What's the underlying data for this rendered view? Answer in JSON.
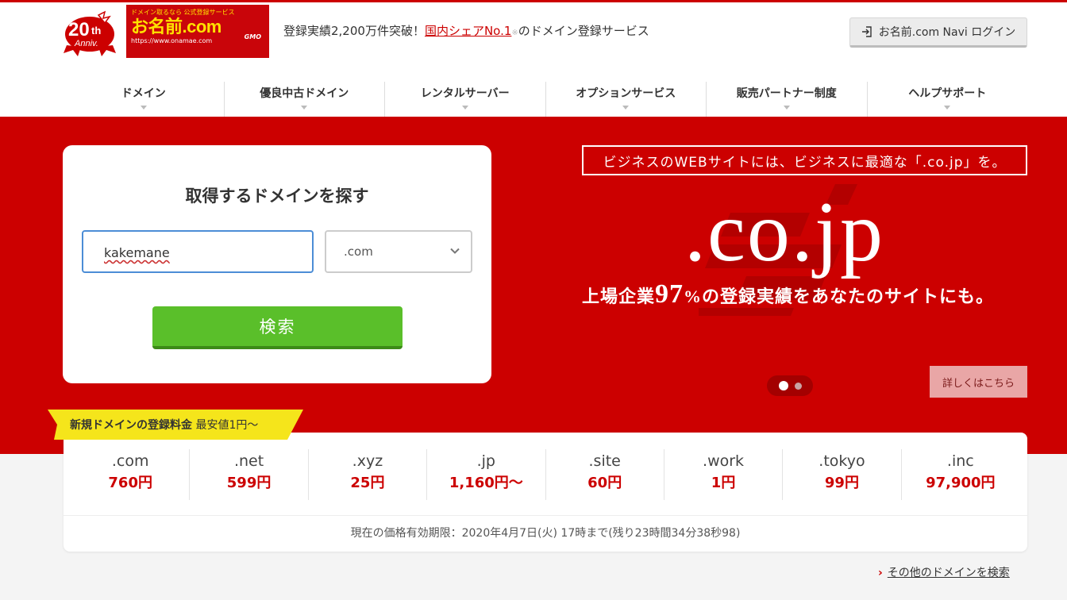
{
  "header": {
    "anniv_badge": "20th Anniv.",
    "logo": {
      "top_text": "ドメイン取るなら 公式登録サービス",
      "name": "お名前.com",
      "url": "https://www.onamae.com",
      "gmo": "GMO"
    },
    "tagline_prefix": "登録実績2,200万件突破！",
    "tagline_link": "国内シェアNo.1",
    "tagline_mark": "※",
    "tagline_suffix": "のドメイン登録サービス",
    "login_label": "お名前.com Navi ログイン"
  },
  "nav": {
    "items": [
      {
        "label": "ドメイン"
      },
      {
        "label": "優良中古ドメイン"
      },
      {
        "label": "レンタルサーバー"
      },
      {
        "label": "オプションサービス"
      },
      {
        "label": "販売パートナー制度"
      },
      {
        "label": "ヘルプサポート"
      }
    ]
  },
  "search": {
    "title": "取得するドメインを探す",
    "input_value": "kakemane",
    "tld_selected": ".com",
    "button_label": "検索"
  },
  "promo": {
    "banner": "ビジネスのWEBサイトには、ビジネスに最適な「.co.jp」を。",
    "headline": ".co.jp",
    "sub_prefix": "上場企業",
    "sub_number": "97",
    "sub_suffix": "%の登録実績をあなたのサイトにも。",
    "detail_label": "詳しくはこちら",
    "slide_count": 2,
    "active_slide": 1
  },
  "pricing": {
    "tag_bold": "新規ドメインの登録料金",
    "tag_rest": "最安値1円〜",
    "items": [
      {
        "tld": ".com",
        "price": "760円"
      },
      {
        "tld": ".net",
        "price": "599円"
      },
      {
        "tld": ".xyz",
        "price": "25円"
      },
      {
        "tld": ".jp",
        "price": "1,160円〜"
      },
      {
        "tld": ".site",
        "price": "60円"
      },
      {
        "tld": ".work",
        "price": "1円"
      },
      {
        "tld": ".tokyo",
        "price": "99円"
      },
      {
        "tld": ".inc",
        "price": "97,900円"
      }
    ],
    "expiry": "現在の価格有効期限：2020年4月7日(火) 17時まで(残り23時間34分38秒98)"
  },
  "footer_link": "その他のドメインを検索",
  "colors": {
    "brand_red": "#cc0000",
    "search_green": "#5abf2a",
    "tag_yellow": "#f5e51b",
    "input_blue": "#4c8dd6"
  }
}
